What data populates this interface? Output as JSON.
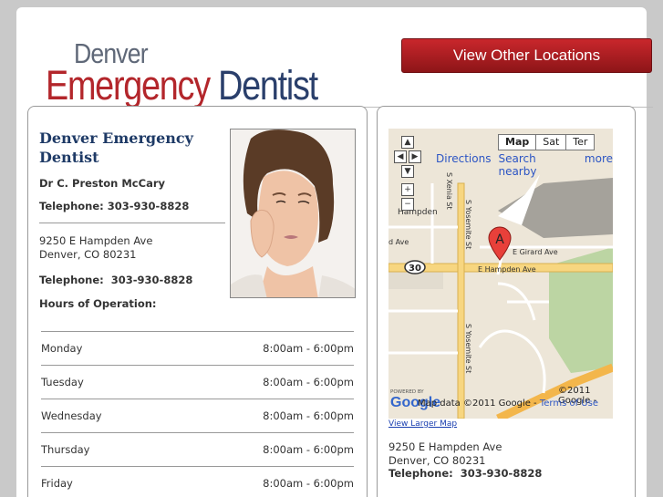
{
  "header": {
    "logo_line1": "Denver",
    "logo_word_red": "Emergency",
    "logo_word_blue": "Dentist",
    "cta_label": "View Other Locations"
  },
  "listing": {
    "title": "Denver Emergency Dentist",
    "doctor": "Dr C. Preston McCary",
    "telephone_label": "Telephone:",
    "telephone": "303-930-8828",
    "telephone_line": "Telephone: 303-930-8828",
    "telephone_line_spaced": "Telephone:  303-930-8828",
    "address_line1": "9250 E Hampden Ave",
    "address_line2": "Denver, CO 80231",
    "hours_title": "Hours of Operation:",
    "hours": [
      {
        "day": "Monday",
        "time": "8:00am - 6:00pm"
      },
      {
        "day": "Tuesday",
        "time": "8:00am - 6:00pm"
      },
      {
        "day": "Wednesday",
        "time": "8:00am - 6:00pm"
      },
      {
        "day": "Thursday",
        "time": "8:00am - 6:00pm"
      },
      {
        "day": "Friday",
        "time": "8:00am - 6:00pm"
      }
    ]
  },
  "map": {
    "type_buttons": [
      "Map",
      "Sat",
      "Ter"
    ],
    "links": [
      "Directions",
      "Search nearby",
      "more"
    ],
    "marker": "A",
    "route_shield": "30",
    "streets": [
      "E Hampden Ave",
      "E Girard Ave",
      "S Yosemite St",
      "S Xenia St"
    ],
    "place": "Hampden",
    "street_partial": "d Ave",
    "powered_by": "POWERED BY",
    "google": "Google",
    "copyright": "©2011 Google -",
    "map_data": "Map data ©2011 Google -",
    "terms": "Terms of Use",
    "larger_link": "View Larger Map",
    "address_line1": "9250 E Hampden Ave",
    "address_line2": "Denver, CO 80231",
    "telephone_line": "Telephone:  303-930-8828"
  },
  "colors": {
    "brand_red": "#b3262b",
    "brand_blue": "#2a3f6b",
    "link_blue": "#2c55c4"
  }
}
